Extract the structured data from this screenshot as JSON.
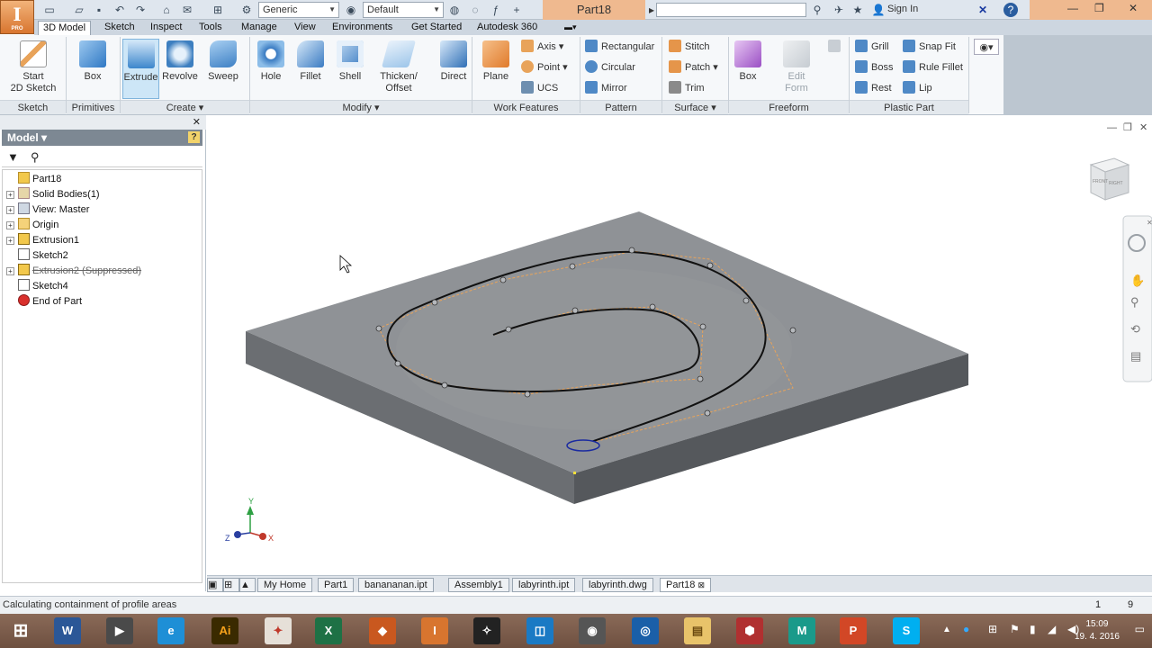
{
  "app": {
    "logo_letter": "I",
    "logo_sub": "PRO",
    "doc_title": "Part18",
    "material": "Generic",
    "appearance": "Default",
    "sign_in": "Sign In",
    "help": "?"
  },
  "ribbon_tabs": [
    "3D Model",
    "Sketch",
    "Inspect",
    "Tools",
    "Manage",
    "View",
    "Environments",
    "Get Started",
    "Autodesk 360"
  ],
  "ribbon": {
    "sketch": {
      "start_2d_sketch_line1": "Start",
      "start_2d_sketch_line2": "2D Sketch",
      "title": "Sketch"
    },
    "primitives": {
      "box": "Box",
      "title": "Primitives"
    },
    "create": {
      "extrude": "Extrude",
      "revolve": "Revolve",
      "sweep": "Sweep",
      "title": "Create"
    },
    "modify": {
      "hole": "Hole",
      "fillet": "Fillet",
      "shell": "Shell",
      "thicken_line1": "Thicken/",
      "thicken_line2": "Offset",
      "direct": "Direct",
      "title": "Modify"
    },
    "work_features": {
      "plane": "Plane",
      "axis": "Axis",
      "point": "Point",
      "ucs": "UCS",
      "title": "Work Features"
    },
    "pattern": {
      "rectangular": "Rectangular",
      "circular": "Circular",
      "mirror": "Mirror",
      "title": "Pattern"
    },
    "surface": {
      "stitch": "Stitch",
      "patch": "Patch",
      "trim": "Trim",
      "title": "Surface"
    },
    "freeform": {
      "box": "Box",
      "edit_form_line1": "Edit",
      "edit_form_line2": "Form",
      "title": "Freeform"
    },
    "plastic_part": {
      "grill": "Grill",
      "boss": "Boss",
      "rest": "Rest",
      "snap_fit": "Snap Fit",
      "rule_fillet": "Rule Fillet",
      "lip": "Lip",
      "title": "Plastic Part"
    }
  },
  "browser": {
    "title": "Model",
    "tree": [
      {
        "label": "Part18",
        "level": 0,
        "expander": "",
        "icon": "part-icon",
        "suppressed": false
      },
      {
        "label": "Solid Bodies(1)",
        "level": 1,
        "expander": "+",
        "icon": "solid-bodies-icon",
        "suppressed": false
      },
      {
        "label": "View: Master",
        "level": 1,
        "expander": "+",
        "icon": "view-icon",
        "suppressed": false
      },
      {
        "label": "Origin",
        "level": 1,
        "expander": "+",
        "icon": "folder-icon",
        "suppressed": false
      },
      {
        "label": "Extrusion1",
        "level": 1,
        "expander": "+",
        "icon": "extrusion-icon",
        "suppressed": false
      },
      {
        "label": "Sketch2",
        "level": 1,
        "expander": "",
        "icon": "sketch-icon",
        "suppressed": false
      },
      {
        "label": "Extrusion2 (Suppressed)",
        "level": 1,
        "expander": "+",
        "icon": "extrusion-icon",
        "suppressed": true
      },
      {
        "label": "Sketch4",
        "level": 1,
        "expander": "",
        "icon": "sketch-icon",
        "suppressed": false
      },
      {
        "label": "End of Part",
        "level": 1,
        "expander": "",
        "icon": "end-of-part-icon",
        "suppressed": false
      }
    ]
  },
  "doc_tabs": [
    "My Home",
    "Part1",
    "banananan.ipt",
    "Assembly1",
    "labyrinth.ipt",
    "labyrinth.dwg",
    "Part18"
  ],
  "active_doc_tab": "Part18",
  "status": {
    "message": "Calculating containment of profile areas",
    "count1": "1",
    "count2": "9"
  },
  "viewcube": {
    "face_front": "FRONT",
    "face_right": "RIGHT"
  },
  "axes": {
    "x": "X",
    "y": "Y",
    "z": "Z"
  },
  "taskbar": {
    "time": "15:09",
    "date": "19. 4. 2016"
  },
  "colors": {
    "accent_tab": "#efb98f",
    "plate_top": "#8e9195",
    "plate_side": "#5f6266",
    "taskbar": "#7a5a48"
  }
}
